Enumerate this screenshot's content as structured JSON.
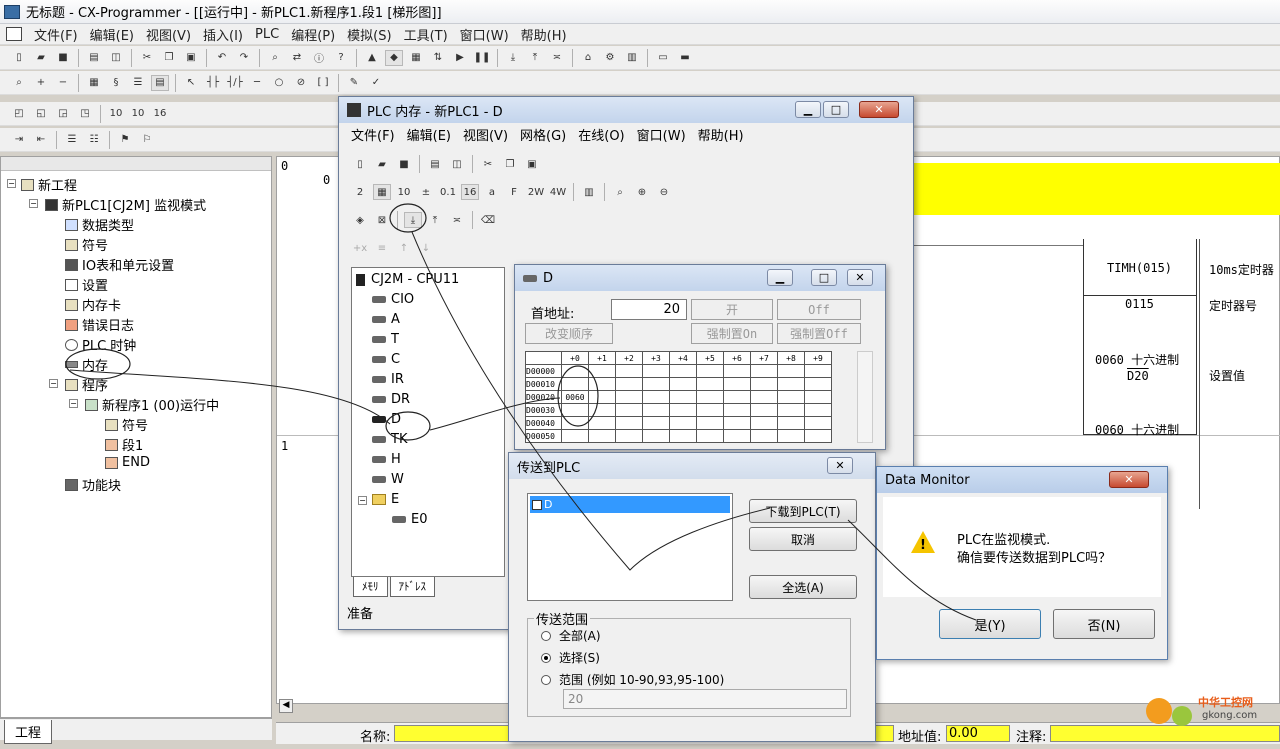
{
  "window": {
    "title": "无标题 - CX-Programmer - [[运行中] - 新PLC1.新程序1.段1 [梯形图]]"
  },
  "menu": [
    "文件(F)",
    "编辑(E)",
    "视图(V)",
    "插入(I)",
    "PLC",
    "编程(P)",
    "模拟(S)",
    "工具(T)",
    "窗口(W)",
    "帮助(H)"
  ],
  "tree": {
    "root": "新工程",
    "plc": "新PLC1[CJ2M] 监视模式",
    "items": [
      "数据类型",
      "符号",
      "IO表和单元设置",
      "设置",
      "内存卡",
      "错误日志",
      "PLC 时钟",
      "内存",
      "程序"
    ],
    "program": "新程序1 (00)运行中",
    "program_items": [
      "符号",
      "段1",
      "END"
    ],
    "function_block": "功能块",
    "tab": "工程"
  },
  "ladder": {
    "rung0": "0",
    "rung0_step": "0",
    "rung1": "1",
    "instruction": "TIMH(015)",
    "ins_op1": "0115",
    "ins_op2a": "0060 十六进制",
    "ins_op2b": "D20",
    "ins_op3": "0060 十六进制",
    "comment1": "10ms定时器",
    "comment2": "定时器号",
    "comment3": "设置值"
  },
  "status": {
    "name_label": "名称:",
    "addr_label": "地址值:",
    "addr_value": "0.00",
    "comment_label": "注释:"
  },
  "mem_window": {
    "title": "PLC 内存 - 新PLC1 - D",
    "menu": [
      "文件(F)",
      "编辑(E)",
      "视图(V)",
      "网格(G)",
      "在线(O)",
      "窗口(W)",
      "帮助(H)"
    ],
    "cpu": "CJ2M - CPU11",
    "areas": [
      "CIO",
      "A",
      "T",
      "C",
      "IR",
      "DR",
      "D",
      "TK",
      "H",
      "W",
      "E",
      "E0"
    ],
    "tabs": [
      "ﾒﾓﾘ",
      "ｱﾄﾞﾚｽ"
    ],
    "status": "准备"
  },
  "d_window": {
    "title": "D",
    "start_label": "首地址:",
    "start_value": "20",
    "btn_open": "开",
    "btn_off": "Off",
    "btn_change_order": "改变顺序",
    "btn_force_on": "强制置On",
    "btn_force_off": "强制置Off",
    "columns": [
      "+0",
      "+1",
      "+2",
      "+3",
      "+4",
      "+5",
      "+6",
      "+7",
      "+8",
      "+9"
    ],
    "rows": [
      {
        "addr": "D00000",
        "cells": [
          "",
          "",
          "",
          "",
          "",
          "",
          "",
          "",
          "",
          ""
        ]
      },
      {
        "addr": "D00010",
        "cells": [
          "",
          "",
          "",
          "",
          "",
          "",
          "",
          "",
          "",
          ""
        ]
      },
      {
        "addr": "D00020",
        "cells": [
          "0060",
          "",
          "",
          "",
          "",
          "",
          "",
          "",
          "",
          ""
        ]
      },
      {
        "addr": "D00030",
        "cells": [
          "",
          "",
          "",
          "",
          "",
          "",
          "",
          "",
          "",
          ""
        ]
      },
      {
        "addr": "D00040",
        "cells": [
          "",
          "",
          "",
          "",
          "",
          "",
          "",
          "",
          "",
          ""
        ]
      },
      {
        "addr": "D00050",
        "cells": [
          "",
          "",
          "",
          "",
          "",
          "",
          "",
          "",
          "",
          ""
        ]
      }
    ]
  },
  "transfer": {
    "title": "传送到PLC",
    "list_item": "D",
    "btn_download": "下载到PLC(T)",
    "btn_cancel": "取消",
    "btn_select_all": "全选(A)",
    "range_label": "传送范围",
    "opt_all": "全部(A)",
    "opt_select": "选择(S)",
    "opt_range": "范围 (例如 10-90,93,95-100)",
    "range_value": "20"
  },
  "monitor": {
    "title": "Data Monitor",
    "line1": "PLC在监视模式.",
    "line2": "确信要传送数据到PLC吗？",
    "btn_yes": "是(Y)",
    "btn_no": "否(N)"
  },
  "watermark": {
    "brand": "中华工控网",
    "url": "gkong.com"
  },
  "colors": {
    "ladder_highlight": "#ffff00",
    "selection": "#3399ff",
    "status_field": "#ffff30"
  }
}
